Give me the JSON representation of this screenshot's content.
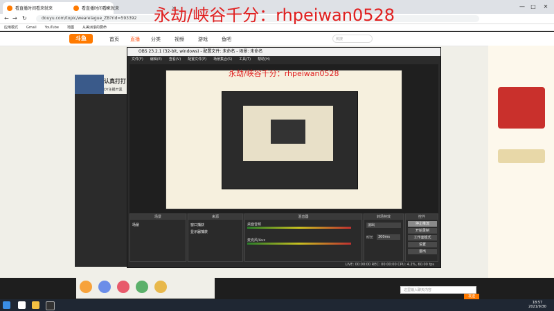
{
  "browser": {
    "tabs": [
      {
        "title": "看直播时间看来就来",
        "active": true
      },
      {
        "title": "看直播时间看来就来",
        "active": false
      }
    ],
    "url": "douyu.com/topic/wearelague_ZB?rid=593392",
    "bookmarks": [
      "应用模式",
      "Gmail",
      "YouTube",
      "地图",
      "从美洲滚的要命"
    ],
    "window_buttons": [
      "—",
      "□",
      "✕"
    ]
  },
  "overlay": {
    "watermark": "永劫/峡谷千分：rhpeiwan0528",
    "preview_watermark": "永劫/峡谷千分：rhpeiwan0528"
  },
  "douyu": {
    "logo": "斗鱼",
    "nav": [
      "首页",
      "直播",
      "分类",
      "视频",
      "游戏",
      "鱼吧"
    ],
    "search_placeholder": "热搜",
    "streamer_title": "认真打打",
    "streamer_sub": "DY主播开黑",
    "chat_placeholder": "这里输入聊天内容",
    "send_label": "发送"
  },
  "obs": {
    "title": "OBS 23.2.1 (32-bit, windows) - 配置文件: 未命名 - 场景: 未命名",
    "menu": [
      "文件(F)",
      "编辑(E)",
      "查看(V)",
      "配置文件(P)",
      "场景集合(S)",
      "工具(T)",
      "帮助(H)"
    ],
    "docks": {
      "scenes": {
        "header": "场景",
        "items": [
          "场景"
        ]
      },
      "sources": {
        "header": "来源",
        "items": [
          "窗口捕获",
          "显示器捕获"
        ]
      },
      "mixer": {
        "header": "混音器",
        "tracks": [
          "桌面音频",
          "麦克风/Aux"
        ]
      },
      "transitions": {
        "header": "转场特效",
        "type": "淡出",
        "duration_label": "时长",
        "duration": "300ms"
      },
      "controls": {
        "header": "控件",
        "buttons": [
          "停止推流",
          "开始录制",
          "工作室模式",
          "设置",
          "退出"
        ]
      }
    },
    "status": "LIVE: 00:00:00   REC: 00:00:00   CPU: 4.2%, 60.00 fps"
  },
  "taskbar": {
    "time": "18:57",
    "date": "2021/9/30"
  }
}
